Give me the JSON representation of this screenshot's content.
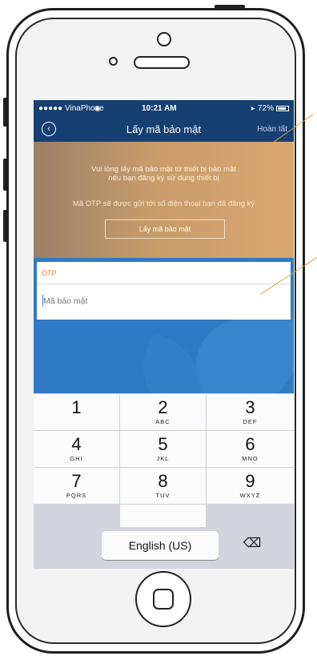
{
  "status_bar": {
    "carrier": "●●●●● VinaPhone",
    "wifi_icon": "wifi-icon",
    "time": "10:21 AM",
    "battery": "72%"
  },
  "nav": {
    "back_icon": "back-circle-icon",
    "title": "Lấy mã bảo mật",
    "done_label": "Hoàn tất"
  },
  "banner": {
    "line1": "Vui lòng lấy mã bảo mật từ thiết bị bảo mật",
    "line2": "nếu bạn đăng ký sử dụng thiết bị",
    "otp_note": "Mã OTP sẽ được gửi tới số điện thoại bạn đã đăng ký",
    "button_label": "Lấy mã bảo mật"
  },
  "form": {
    "otp_label": "OTP",
    "code_placeholder": "Mã bảo mật"
  },
  "keypad": {
    "keys": [
      {
        "num": "1",
        "letters": ""
      },
      {
        "num": "2",
        "letters": "ABC"
      },
      {
        "num": "3",
        "letters": "DEF"
      },
      {
        "num": "4",
        "letters": "GHI"
      },
      {
        "num": "5",
        "letters": "JKL"
      },
      {
        "num": "6",
        "letters": "MNO"
      },
      {
        "num": "7",
        "letters": "PQRS"
      },
      {
        "num": "8",
        "letters": "TUV"
      },
      {
        "num": "9",
        "letters": "WXYZ"
      }
    ],
    "language_label": "English (US)",
    "delete_icon": "backspace-icon"
  },
  "colors": {
    "nav_bg": "#163f72",
    "accent_orange": "#e2793d",
    "callout": "#d8a046"
  }
}
